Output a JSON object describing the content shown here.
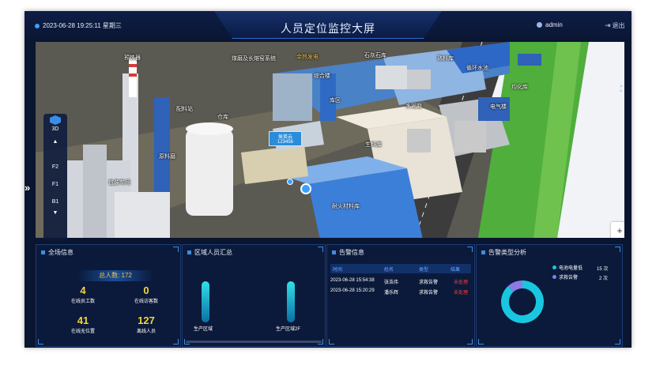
{
  "header": {
    "datetime": "2023-06-28 19:25:11 星期三",
    "title": "人员定位监控大屏",
    "user": "admin",
    "logout": "退出"
  },
  "map": {
    "labels": [
      {
        "text": "预热器",
        "gold": false
      },
      {
        "text": "煤磨及长熔窑系统",
        "gold": false
      },
      {
        "text": "余热发电",
        "gold": false
      },
      {
        "text": "综合楼",
        "gold": false
      },
      {
        "text": "石灰石库",
        "gold": false
      },
      {
        "text": "熟料库",
        "gold": false
      },
      {
        "text": "循环水池",
        "gold": false
      },
      {
        "text": "均化库",
        "gold": false
      },
      {
        "text": "库区",
        "gold": false
      },
      {
        "text": "水泥磨",
        "gold": false
      },
      {
        "text": "电气楼",
        "gold": false
      },
      {
        "text": "仓库",
        "gold": false
      },
      {
        "text": "配料站",
        "gold": false
      },
      {
        "text": "原料磨",
        "gold": false
      },
      {
        "text": "生料库",
        "gold": false
      },
      {
        "text": "耐火材料库",
        "gold": false
      },
      {
        "text": "包装车间",
        "gold": false
      }
    ],
    "marker_name": "侯英云",
    "marker_id": "123456",
    "floors": [
      "3D",
      "F2",
      "F1",
      "B1"
    ],
    "zoom_in": "+",
    "zoom_out": "−"
  },
  "site_info": {
    "title": "全场信息",
    "total": "总人数: 172",
    "stats": [
      {
        "value": "4",
        "label": "在线员工数"
      },
      {
        "value": "0",
        "label": "在线访客数"
      },
      {
        "value": "41",
        "label": "在线无位置"
      },
      {
        "value": "127",
        "label": "离线人员"
      }
    ]
  },
  "area_summary": {
    "title": "区域人员汇总",
    "areas": [
      {
        "label": "生产区域",
        "value": 1.0
      },
      {
        "label": "生产区域2F",
        "value": 1.0
      }
    ]
  },
  "alarm_info": {
    "title": "告警信息",
    "columns": [
      "时间",
      "姓名",
      "类型",
      "结果"
    ],
    "rows": [
      {
        "time": "2023-06-28 15:54:38",
        "name": "张浩伟",
        "type": "求救告警",
        "result": "未处理"
      },
      {
        "time": "2023-06-28 15:20:29",
        "name": "潘乐辉",
        "type": "求救告警",
        "result": "未处理"
      }
    ]
  },
  "alarm_types": {
    "title": "告警类型分析",
    "chart_data": {
      "type": "pie",
      "series": [
        {
          "name": "电池电量低",
          "value": 15,
          "color": "#19c6e0"
        },
        {
          "name": "求救告警",
          "value": 2,
          "color": "#8b7be8"
        }
      ],
      "unit": "次"
    }
  }
}
